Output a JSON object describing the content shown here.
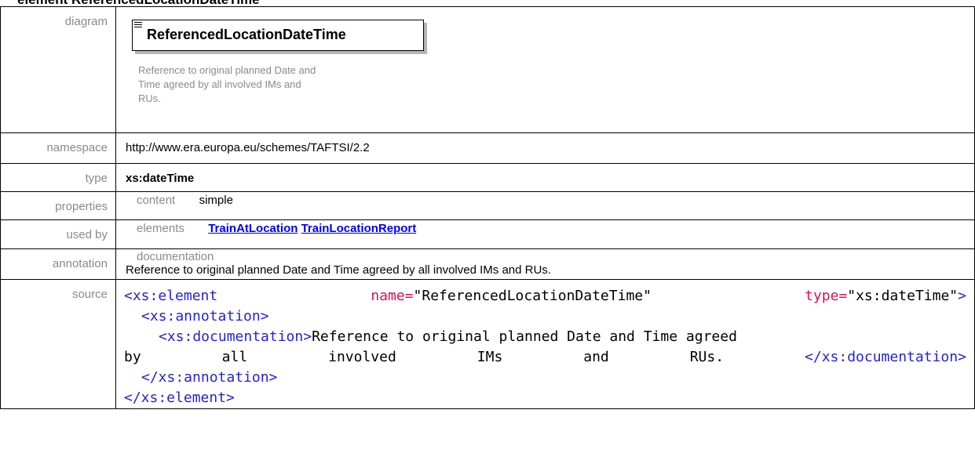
{
  "heading": "element ReferencedLocationDateTime",
  "rows": {
    "diagram": {
      "label": "diagram",
      "element_name": "ReferencedLocationDateTime",
      "doc_lines": [
        "Reference to original planned Date and",
        "Time agreed by all involved IMs and",
        "RUs."
      ]
    },
    "namespace": {
      "label": "namespace",
      "value": "http://www.era.europa.eu/schemes/TAFTSI/2.2"
    },
    "type": {
      "label": "type",
      "value": "xs:dateTime"
    },
    "properties": {
      "label": "properties",
      "sublabel": "content",
      "value": "simple"
    },
    "used_by": {
      "label": "used by",
      "sublabel": "elements",
      "links": [
        "TrainAtLocation",
        "TrainLocationReport"
      ]
    },
    "annotation": {
      "label": "annotation",
      "sublabel": "documentation",
      "value": "Reference to original planned Date and Time agreed by all involved IMs and RUs."
    },
    "source": {
      "label": "source",
      "line1": {
        "open": "<xs:element",
        "name_attr": "name=",
        "name_val": "\"ReferencedLocationDateTime\"",
        "type_attr": "type=",
        "type_val": "\"xs:dateTime\"",
        "close": ">"
      },
      "line2": "<xs:annotation>",
      "line3": {
        "open": "<xs:documentation>",
        "text": "Reference to original planned Date and Time agreed"
      },
      "line4": {
        "w1": "by",
        "w2": "all",
        "w3": "involved",
        "w4": "IMs",
        "w5": "and",
        "w6": "RUs.",
        "close": "</xs:documentation>"
      },
      "line5": "</xs:annotation>",
      "line6": "</xs:element>"
    }
  }
}
